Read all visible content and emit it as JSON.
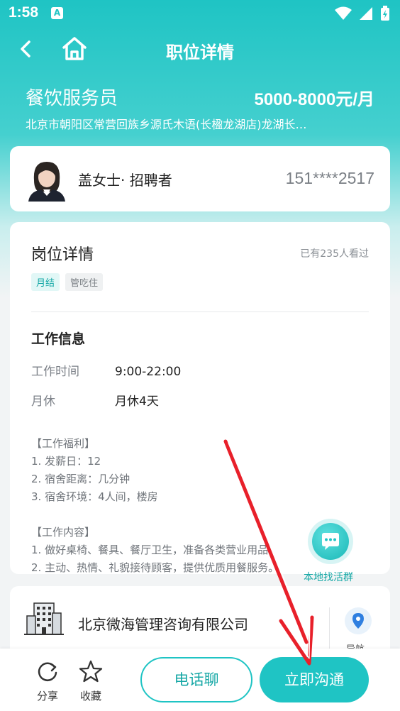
{
  "status_bar": {
    "time": "1:58",
    "notification": "A"
  },
  "nav": {
    "title": "职位详情"
  },
  "job": {
    "title": "餐饮服务员",
    "salary": "5000-8000元/月",
    "address": "北京市朝阳区常营回族乡源氏木语(长楹龙湖店)龙湖长…"
  },
  "recruiter": {
    "name": "盖女士· 招聘者",
    "phone": "151****2517"
  },
  "details": {
    "title": "岗位详情",
    "view_count": "已有235人看过",
    "tags": [
      "月结",
      "管吃住"
    ],
    "info_heading": "工作信息",
    "work_time_label": "工作时间",
    "work_time_value": "9:00-22:00",
    "rest_label": "月休",
    "rest_value": "月休4天",
    "description": "【工作福利】\n1. 发薪日：12\n2. 宿舍距离：几分钟\n3. 宿舍环境：4人间，楼房\n\n【工作内容】\n1. 做好桌椅、餐具、餐厅卫生，准备各类营业用品。\n2. 主动、热情、礼貌接待顾客，提供优质用餐服务。"
  },
  "float_button": {
    "label": "本地找活群"
  },
  "company": {
    "name": "北京微海管理咨询有限公司",
    "nav_label": "导航"
  },
  "bottom_bar": {
    "share_label": "分享",
    "favorite_label": "收藏",
    "call_label": "电话聊",
    "chat_label": "立即沟通"
  },
  "colors": {
    "accent": "#1fc4c4",
    "annotation_arrow": "#e8202a"
  }
}
